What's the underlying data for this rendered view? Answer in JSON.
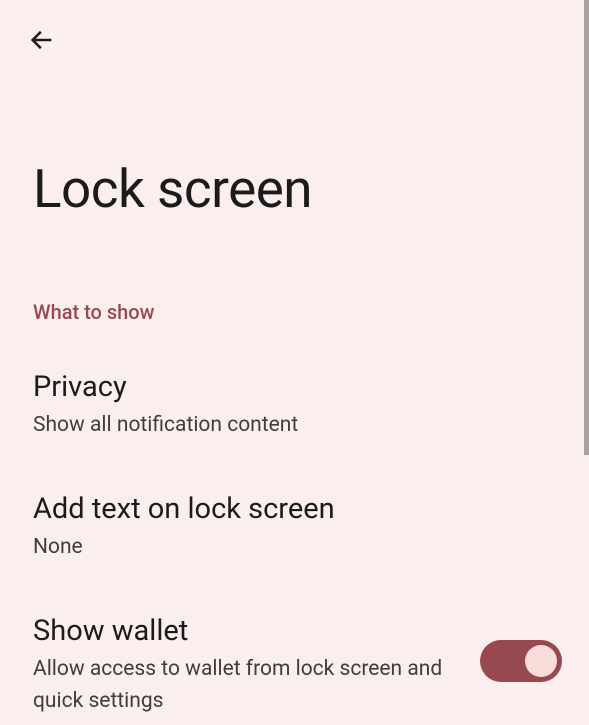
{
  "page": {
    "title": "Lock screen"
  },
  "section": {
    "header": "What to show"
  },
  "settings": {
    "privacy": {
      "title": "Privacy",
      "subtitle": "Show all notification content"
    },
    "addText": {
      "title": "Add text on lock screen",
      "subtitle": "None"
    },
    "wallet": {
      "title": "Show wallet",
      "subtitle": "Allow access to wallet from lock screen and quick settings",
      "enabled": true
    }
  }
}
